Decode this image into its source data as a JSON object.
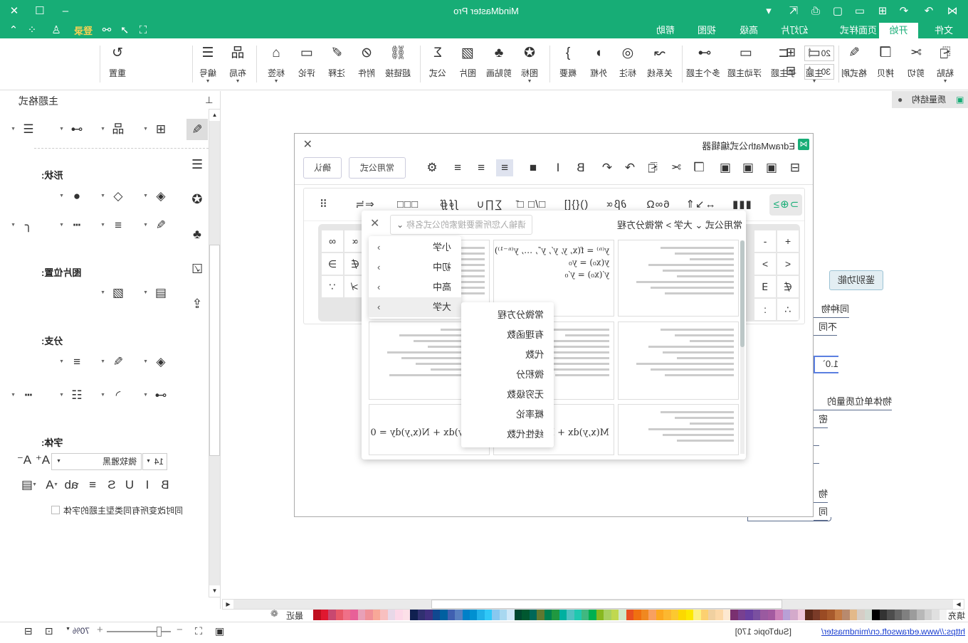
{
  "app": {
    "title": "MindMaster Pro",
    "brand_color": "#17ad76"
  },
  "titlebar": {
    "icons": [
      "mindmaster-logo-icon",
      "redo-icon",
      "undo-icon",
      "new-icon",
      "open-icon",
      "save-icon",
      "print-icon",
      "export-icon",
      "more-icon"
    ],
    "window": [
      "minimize-icon",
      "maximize-icon",
      "close-icon"
    ]
  },
  "tabs": [
    {
      "label": "文件"
    },
    {
      "label": "开始",
      "active": true
    },
    {
      "label": "页面样式"
    },
    {
      "label": "幻灯片"
    },
    {
      "label": "高级"
    },
    {
      "label": "视图"
    },
    {
      "label": "帮助"
    }
  ],
  "login": "登录",
  "quick_icons": [
    "fullscreen-icon",
    "select-icon",
    "share-icon",
    "theme-icon",
    "apps-icon",
    "collapse-icon"
  ],
  "ribbon": {
    "buttons": [
      {
        "label": "粘贴",
        "icon": "paste-icon",
        "dropdown": true
      },
      {
        "label": "剪切",
        "icon": "cut-icon"
      },
      {
        "label": "拷贝",
        "icon": "copy-icon"
      },
      {
        "label": "格式刷",
        "icon": "format-painter-icon"
      },
      {
        "label": "主题",
        "icon": "topic-icon",
        "dropdown": true
      },
      {
        "label": "子主题",
        "icon": "subtopic-icon"
      },
      {
        "label": "浮动主题",
        "icon": "floating-topic-icon"
      },
      {
        "label": "多个主题",
        "icon": "multiple-topics-icon"
      },
      {
        "label": "关系线",
        "icon": "relationship-icon"
      },
      {
        "label": "标注",
        "icon": "callout-icon"
      },
      {
        "label": "外框",
        "icon": "boundary-icon"
      },
      {
        "label": "概要",
        "icon": "summary-icon"
      },
      {
        "label": "图标",
        "icon": "icon-icon",
        "dropdown": true
      },
      {
        "label": "剪贴画",
        "icon": "clipart-icon"
      },
      {
        "label": "图片",
        "icon": "image-icon"
      },
      {
        "label": "公式",
        "icon": "formula-icon"
      },
      {
        "label": "超链接",
        "icon": "hyperlink-icon"
      },
      {
        "label": "附件",
        "icon": "attachment-icon"
      },
      {
        "label": "注释",
        "icon": "note-icon"
      },
      {
        "label": "评论",
        "icon": "comment-icon"
      },
      {
        "label": "标签",
        "icon": "tag-icon",
        "dropdown": true
      },
      {
        "label": "布局",
        "icon": "layout-icon",
        "dropdown": true
      },
      {
        "label": "编号",
        "icon": "numbering-icon",
        "dropdown": true
      },
      {
        "label": "重置",
        "icon": "reset-icon"
      }
    ],
    "spacing_h": "20",
    "spacing_v": "30"
  },
  "doc_tab": {
    "label": "质量结构"
  },
  "panel": {
    "title": "主题格式",
    "shape": "形状:",
    "image_pos": "图片位置:",
    "branch": "分支:",
    "font": "字体:",
    "font_name": "微软雅黑",
    "font_size": "14",
    "checkbox_label": "同时改变所有同类型主题的字体",
    "checkbox_checked": false
  },
  "canvas": {
    "nodes": [
      "鉴别功能",
      "同种物",
      "不同",
      "1.0`",
      "物体单位质量的",
      "密",
      "—",
      "—",
      "物",
      "同"
    ]
  },
  "dialog": {
    "title": "EdrawMath公式编辑器",
    "confirm": "确认",
    "common_formulas": "常用公式",
    "symbol_groups": [
      "⊃⊕≥",
      "▮▮▮",
      "↔↘⇑",
      "6∞Ω",
      "∂β∝",
      "(){}[]",
      "□/□ □̄",
      "∑∏∪",
      "∫∮∯",
      "□□□",
      "⇐≒",
      "⠿"
    ],
    "keys": [
      "+",
      "-",
      "<",
      ">",
      "∉",
      "∃",
      "∴",
      ":",
      "∞",
      "∝",
      "∋",
      "∉",
      "∵",
      "≯"
    ]
  },
  "library": {
    "search_placeholder": "请输入您所需要搜索的公式名称",
    "breadcrumb": [
      "常用公式",
      "大学",
      "常微分方程"
    ],
    "levels": [
      {
        "label": "小学"
      },
      {
        "label": "初中"
      },
      {
        "label": "高中"
      },
      {
        "label": "大学",
        "highlighted": true
      }
    ],
    "categories": [
      "常微分方程",
      "有理函数",
      "代数",
      "微积分",
      "无穷级数",
      "概率论",
      "线性代数"
    ],
    "formulas": [
      "y⁽ⁿ⁾ = f(x, y, y′, y″, …, y⁽ⁿ⁻¹⁾)",
      "y(x₀) = y₀",
      "y′(x₀) = y′₀",
      "M(x,y)dx + N(x,y)dy = 0"
    ]
  },
  "palette": {
    "label": "填充",
    "recent": "最近",
    "colors": [
      "#f2f2f2",
      "#e0e0e0",
      "#d0d0d0",
      "#b8b8b8",
      "#9c9c9c",
      "#808080",
      "#666666",
      "#4d4d4d",
      "#333333",
      "#000000",
      "#cfd8d0",
      "#d6cdc6",
      "#e3b98a",
      "#b88a6e",
      "#c47b44",
      "#a85a2c",
      "#9a4b24",
      "#7a3b28",
      "#5e2a1a",
      "#f0c8dc",
      "#d4aacb",
      "#b8a0d6",
      "#cc80b8",
      "#a45aa0",
      "#9a5aa0",
      "#7a50a0",
      "#6a40a0",
      "#784090",
      "#7a3070",
      "#fde8d0",
      "#fcd8a8",
      "#f0d0a0",
      "#fcd070",
      "#fcf080",
      "#fce800",
      "#fcd800",
      "#fcc830",
      "#fcb830",
      "#fca820",
      "#f8a060",
      "#f08820",
      "#f07010",
      "#e85020",
      "#d0e8c8",
      "#c0d850",
      "#a8d060",
      "#88b820",
      "#00b050",
      "#40b880",
      "#20c8b0",
      "#50c0c0",
      "#00b0a0",
      "#209840",
      "#008050",
      "#607830",
      "#006858",
      "#005830",
      "#004830",
      "#d0e8f8",
      "#a8d8f0",
      "#88c8f0",
      "#30c8f8",
      "#20b0e8",
      "#0090d0",
      "#0080c8",
      "#5880c0",
      "#4060b0",
      "#0060a0",
      "#104890",
      "#403080",
      "#303070",
      "#102050",
      "#fce0e8",
      "#fcd8e8",
      "#e8d8e8",
      "#f8c0c0",
      "#f8a898",
      "#f09098",
      "#e8a0b8",
      "#e86098",
      "#f07088",
      "#e85868",
      "#c84870",
      "#e01830",
      "#c01020"
    ]
  },
  "status": {
    "url": "https://www.edrawsoft.cn/mindmaster/",
    "selection": "[SubTopic 170]",
    "zoom": "70%",
    "zoom_level": 0.7
  }
}
